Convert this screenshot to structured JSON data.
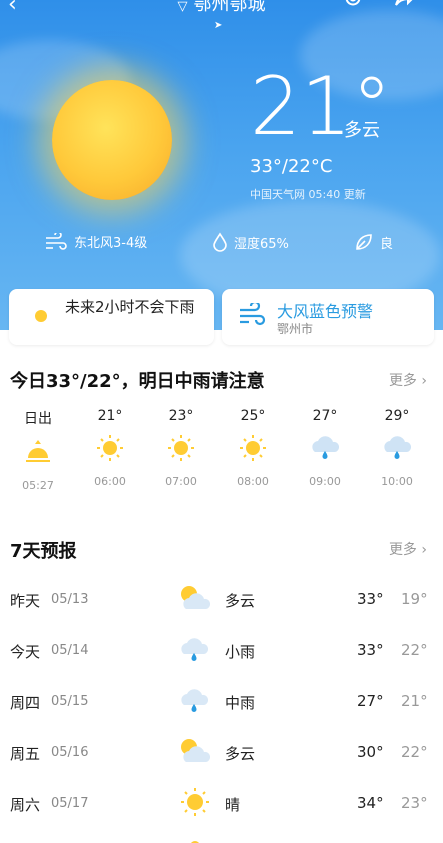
{
  "header": {
    "city": "鄂州鄂城"
  },
  "current": {
    "temperature": "21°",
    "condition": "多云",
    "range": "33°/22°C",
    "source": "中国天气网 05:40 更新"
  },
  "metrics": [
    {
      "icon": "wind-icon",
      "label": "东北风3-4级"
    },
    {
      "icon": "humidity-drop-icon",
      "label": "湿度65%"
    },
    {
      "icon": "leaf-icon",
      "label": "良"
    }
  ],
  "cards": {
    "rain": {
      "text": "未来2小时不会下雨"
    },
    "alert": {
      "title": "大风蓝色预警",
      "area": "鄂州市",
      "color": "#2a9be0"
    }
  },
  "today": {
    "title": "今日33°/22°，明日中雨请注意",
    "more": "更多",
    "hours": [
      {
        "label": "日出",
        "icon": "sunrise-icon",
        "time": "05:27"
      },
      {
        "label": "21°",
        "icon": "sun-icon",
        "time": "06:00"
      },
      {
        "label": "23°",
        "icon": "sun-icon",
        "time": "07:00"
      },
      {
        "label": "25°",
        "icon": "sun-icon",
        "time": "08:00"
      },
      {
        "label": "27°",
        "icon": "rain-cloud-icon",
        "time": "09:00"
      },
      {
        "label": "29°",
        "icon": "rain-cloud-icon",
        "time": "10:00"
      }
    ]
  },
  "forecast": {
    "title": "7天预报",
    "more": "更多",
    "days": [
      {
        "name": "昨天",
        "date": "05/13",
        "icon": "partly-cloudy-icon",
        "condition": "多云",
        "high": "33°",
        "low": "19°"
      },
      {
        "name": "今天",
        "date": "05/14",
        "icon": "rain-cloud-icon",
        "condition": "小雨",
        "high": "33°",
        "low": "22°"
      },
      {
        "name": "周四",
        "date": "05/15",
        "icon": "rain-cloud-icon",
        "condition": "中雨",
        "high": "27°",
        "low": "21°"
      },
      {
        "name": "周五",
        "date": "05/16",
        "icon": "partly-cloudy-icon",
        "condition": "多云",
        "high": "30°",
        "low": "22°"
      },
      {
        "name": "周六",
        "date": "05/17",
        "icon": "sun-icon",
        "condition": "晴",
        "high": "34°",
        "low": "23°"
      }
    ]
  },
  "colors": {
    "sky": "#3a97ec",
    "sun": "#ffc93a",
    "accent": "#2a9be0"
  }
}
